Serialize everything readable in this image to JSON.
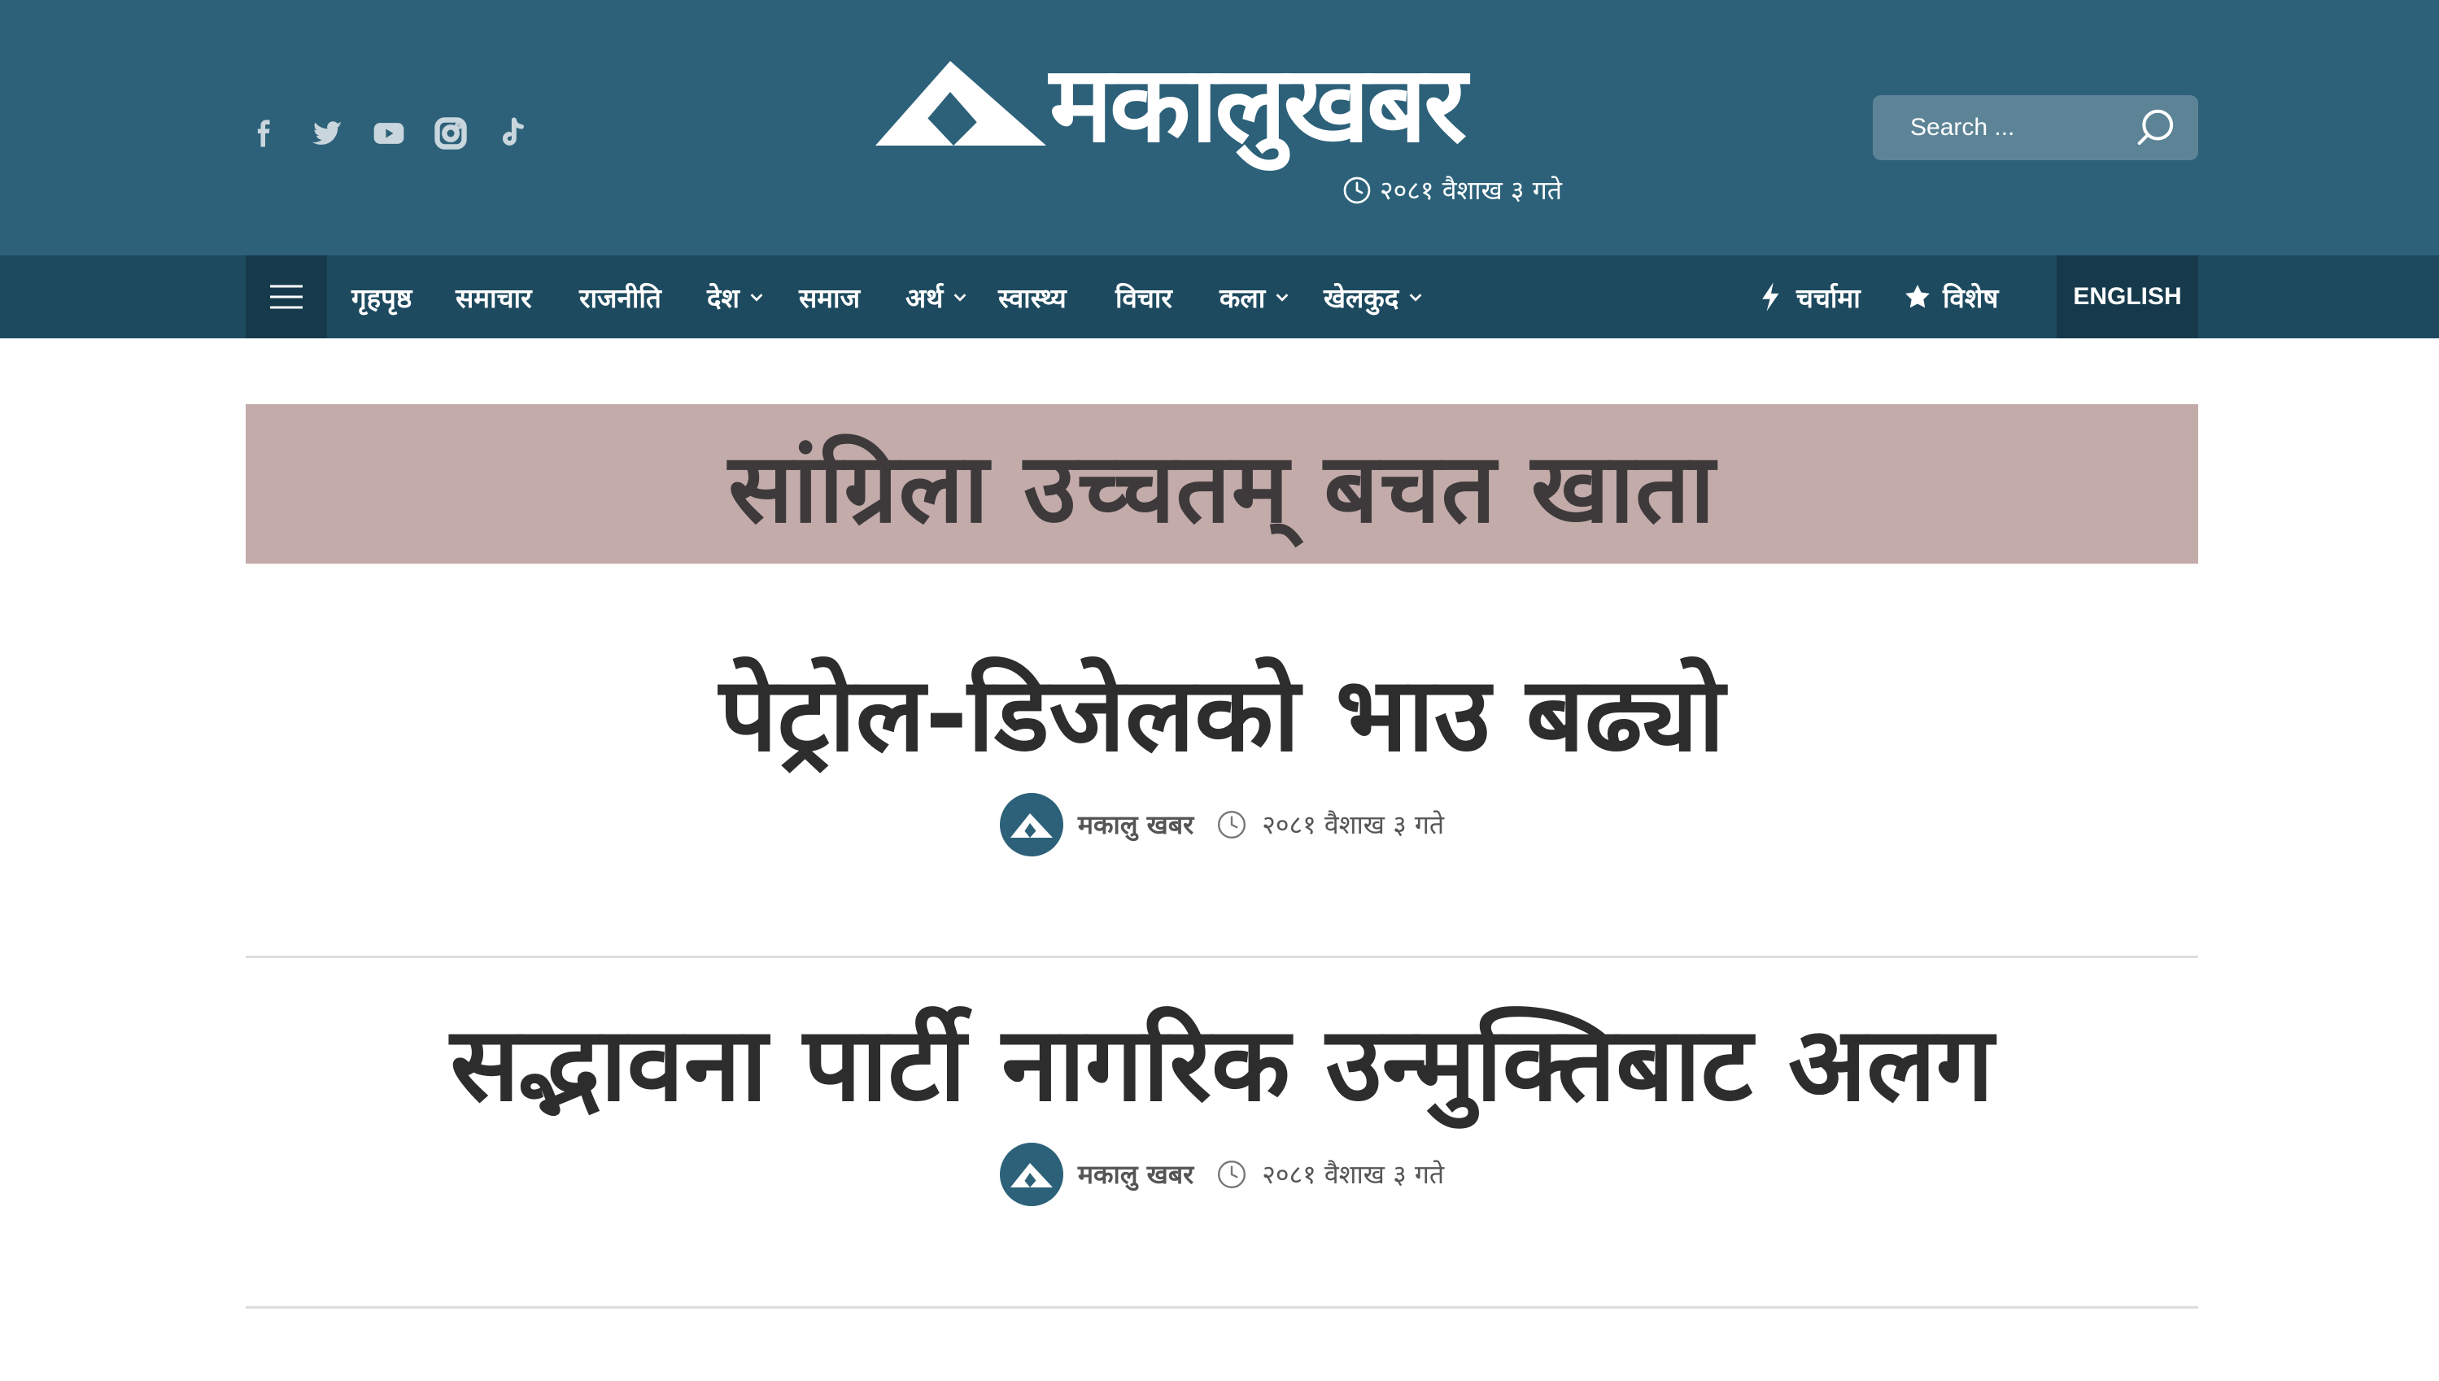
{
  "header": {
    "logo_text": "मकालुखबर",
    "date": "२०८१ वैशाख ३ गते",
    "social_icons": [
      "facebook-icon",
      "twitter-icon",
      "youtube-icon",
      "instagram-icon",
      "tiktok-icon"
    ]
  },
  "search": {
    "placeholder": "Search ..."
  },
  "nav": {
    "items": [
      {
        "label": "गृहपृष्ठ"
      },
      {
        "label": "समाचार"
      },
      {
        "label": "राजनीति"
      },
      {
        "label": "देश"
      },
      {
        "label": "समाज"
      },
      {
        "label": "अर्थ"
      },
      {
        "label": "स्वास्थ्य"
      },
      {
        "label": "विचार"
      },
      {
        "label": "कला"
      },
      {
        "label": "खेलकुद"
      }
    ],
    "trending_label": "चर्चामा",
    "special_label": "विशेष",
    "english_label": "ENGLISH"
  },
  "ad": {
    "text": "सांग्रिला उच्चतम् बचत खाता"
  },
  "articles": [
    {
      "title": "पेट्रोल-डिजेलको भाउ बढ्यो",
      "author": "मकालु खबर",
      "date": "२०८१ वैशाख ३ गते"
    },
    {
      "title": "सद्भावना पार्टी नागरिक उन्मुक्तिबाट अलग",
      "author": "मकालु खबर",
      "date": "२०८१ वैशाख ३ गते"
    }
  ],
  "colors": {
    "header_bg": "#2c6179",
    "nav_bg": "#1d4a5f",
    "nav_dark": "#163a4b",
    "ad_bg": "#c3abaa"
  }
}
